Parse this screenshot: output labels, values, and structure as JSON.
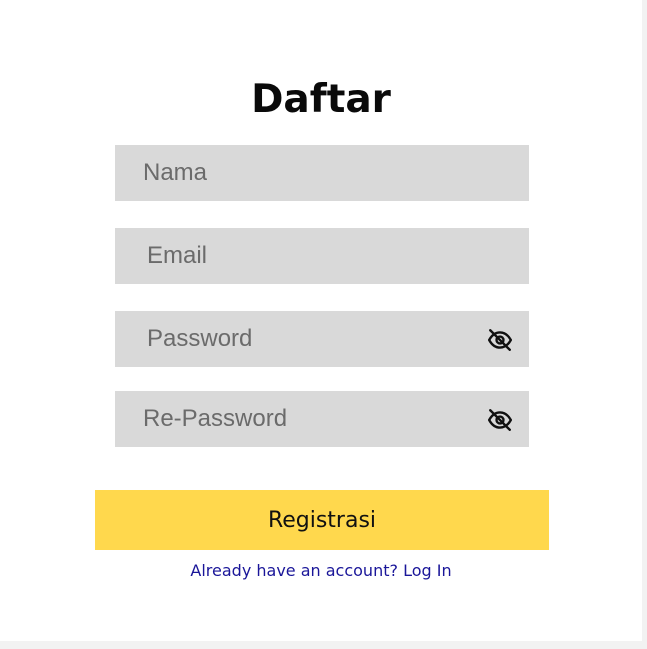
{
  "form": {
    "title": "Daftar",
    "fields": {
      "name": {
        "placeholder": "Nama",
        "value": ""
      },
      "email": {
        "placeholder": "Email",
        "value": ""
      },
      "password": {
        "placeholder": "Password",
        "value": "",
        "icon": "eye-off-icon"
      },
      "repassword": {
        "placeholder": "Re-Password",
        "value": "",
        "icon": "eye-off-icon"
      }
    },
    "submit_label": "Registrasi",
    "login_prompt": "Already have an account?",
    "login_link": "Log In"
  },
  "colors": {
    "background": "#ffffff",
    "field_background": "#d9d9d9",
    "button_background": "#ffd84d",
    "link": "#1a1699"
  }
}
